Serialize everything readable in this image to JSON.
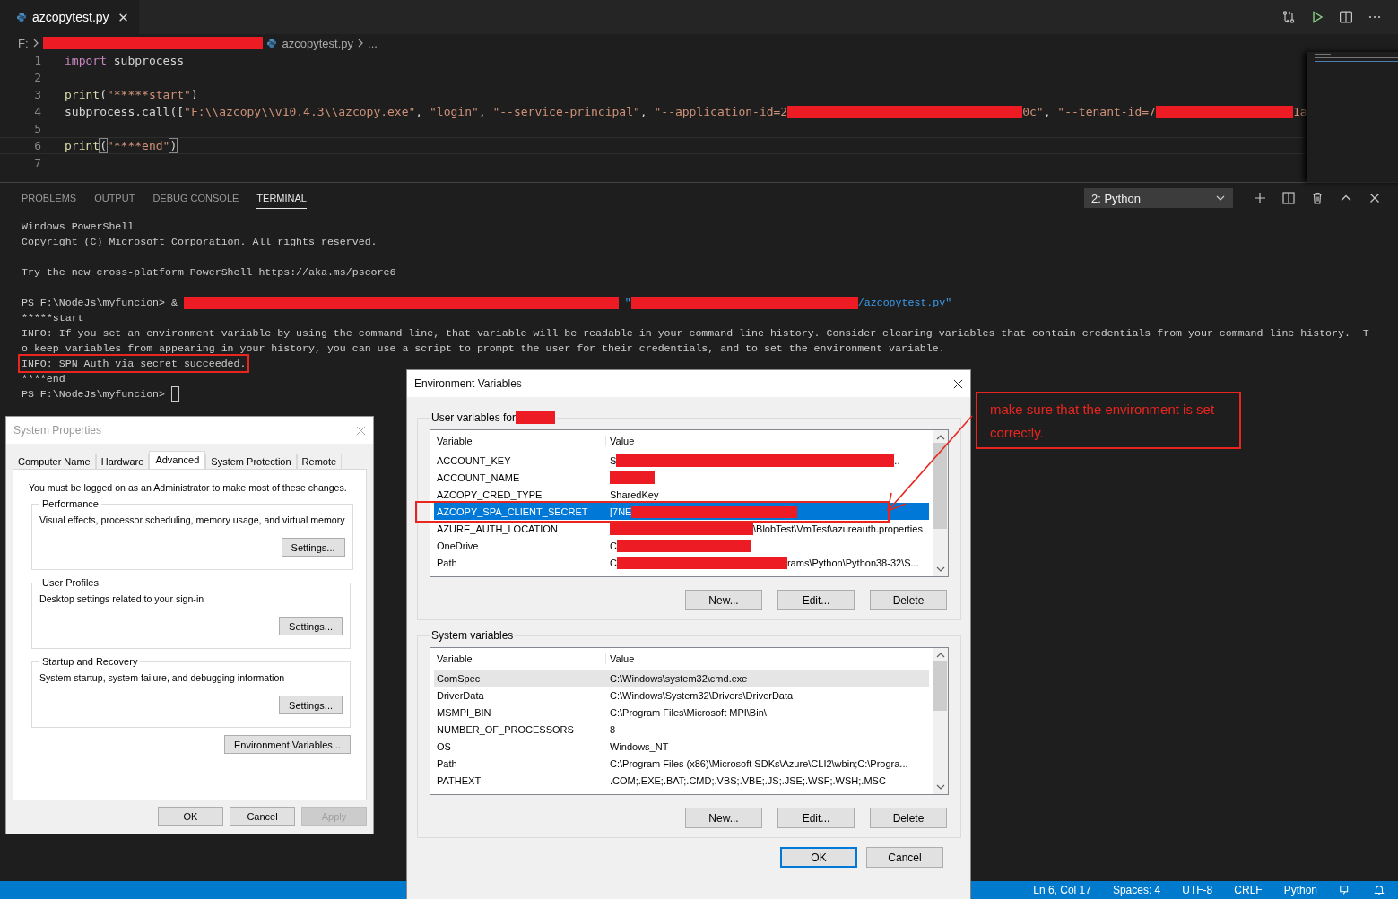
{
  "editor": {
    "tab": {
      "label": "azcopytest.py",
      "selected": true
    },
    "breadcrumb": [
      {
        "kind": "text",
        "text": "F:"
      },
      {
        "kind": "redacted"
      },
      {
        "kind": "file",
        "text": "azcopytest.py"
      },
      {
        "kind": "text",
        "text": "..."
      }
    ],
    "code_lines": [
      {
        "number": "1",
        "current": false,
        "segments": [
          {
            "kind": "keyword",
            "text": "import"
          },
          {
            "kind": "plain",
            "text": " subprocess"
          }
        ]
      },
      {
        "number": "2",
        "current": false
      },
      {
        "number": "3",
        "current": false,
        "segments": [
          {
            "kind": "func",
            "text": "print"
          },
          {
            "kind": "plain",
            "text": "("
          },
          {
            "kind": "string",
            "text": "\"*****start\""
          },
          {
            "kind": "plain",
            "text": ")"
          }
        ]
      },
      {
        "number": "4",
        "current": false,
        "segments": [
          {
            "kind": "plain",
            "text": "subprocess.call(["
          },
          {
            "kind": "string",
            "text": "\"F:\\\\azcopy\\\\v10.4.3\\\\azcopy.exe\""
          },
          {
            "kind": "plain",
            "text": ", "
          },
          {
            "kind": "string",
            "text": "\"login\""
          },
          {
            "kind": "plain",
            "text": ", "
          },
          {
            "kind": "string",
            "text": "\"--service-principal\""
          },
          {
            "kind": "plain",
            "text": ", "
          },
          {
            "kind": "string",
            "text": "\"--application-id=2"
          },
          {
            "kind": "redacted"
          },
          {
            "kind": "string",
            "text": "0c\""
          },
          {
            "kind": "plain",
            "text": ", "
          },
          {
            "kind": "string",
            "text": "\"--tenant-id=7"
          },
          {
            "kind": "redacted"
          },
          {
            "kind": "string",
            "text": "1a"
          }
        ]
      },
      {
        "number": "5",
        "current": false
      },
      {
        "number": "6",
        "current": true,
        "segments": [
          {
            "kind": "func",
            "text": "print"
          },
          {
            "kind": "bracket",
            "text": "("
          },
          {
            "kind": "string",
            "text": "\"****end\""
          },
          {
            "kind": "bracket",
            "text": ")"
          }
        ]
      },
      {
        "number": "7",
        "current": false
      }
    ]
  },
  "panel": {
    "tabs": [
      {
        "label": "PROBLEMS",
        "selected": false
      },
      {
        "label": "OUTPUT",
        "selected": false
      },
      {
        "label": "DEBUG CONSOLE",
        "selected": false
      },
      {
        "label": "TERMINAL",
        "selected": true
      }
    ],
    "terminal_select": "2: Python",
    "terminal_lines": [
      {
        "kind": "text",
        "boxed": false,
        "cursor": false,
        "segments": [
          {
            "kind": "text",
            "text": "Windows PowerShell"
          }
        ]
      },
      {
        "kind": "text",
        "boxed": false,
        "cursor": false,
        "segments": [
          {
            "kind": "text",
            "text": "Copyright (C) Microsoft Corporation. All rights reserved."
          }
        ]
      },
      {
        "kind": "blank"
      },
      {
        "kind": "text",
        "boxed": false,
        "cursor": false,
        "segments": [
          {
            "kind": "text",
            "text": "Try the new cross-platform PowerShell https://aka.ms/pscore6"
          }
        ]
      },
      {
        "kind": "blank"
      },
      {
        "kind": "text",
        "boxed": false,
        "cursor": false,
        "segments": [
          {
            "kind": "text",
            "text": "PS F:\\NodeJs\\myfuncion> & "
          },
          {
            "kind": "redacted"
          },
          {
            "kind": "string",
            "text": " \""
          },
          {
            "kind": "redacted"
          },
          {
            "kind": "string",
            "text": "/azcopytest.py\""
          }
        ]
      },
      {
        "kind": "text",
        "boxed": false,
        "cursor": false,
        "segments": [
          {
            "kind": "text",
            "text": "*****start"
          }
        ]
      },
      {
        "kind": "text",
        "boxed": false,
        "cursor": false,
        "segments": [
          {
            "kind": "text",
            "text": "INFO: If you set an environment variable by using the command line, that variable will be readable in your command line history. Consider clearing variables that contain credentials from your command line history.  T"
          }
        ]
      },
      {
        "kind": "text",
        "boxed": false,
        "cursor": false,
        "segments": [
          {
            "kind": "text",
            "text": "o keep variables from appearing in your history, you can use a script to prompt the user for their credentials, and to set the environment variable."
          }
        ]
      },
      {
        "kind": "text",
        "boxed": true,
        "cursor": false,
        "segments": [
          {
            "kind": "text",
            "text": "INFO: SPN Auth via secret succeeded."
          }
        ]
      },
      {
        "kind": "text",
        "boxed": false,
        "cursor": false,
        "segments": [
          {
            "kind": "text",
            "text": "****end"
          }
        ]
      },
      {
        "kind": "text",
        "boxed": false,
        "cursor": true,
        "segments": [
          {
            "kind": "text",
            "text": "PS F:\\NodeJs\\myfuncion> "
          }
        ]
      }
    ]
  },
  "system_properties": {
    "title": "System Properties",
    "tabs": [
      {
        "label": "Computer Name",
        "selected": false
      },
      {
        "label": "Hardware",
        "selected": false
      },
      {
        "label": "Advanced",
        "selected": true
      },
      {
        "label": "System Protection",
        "selected": false
      },
      {
        "label": "Remote",
        "selected": false
      }
    ],
    "note": "You must be logged on as an Administrator to make most of these changes.",
    "groups": [
      {
        "title": "Performance",
        "description": "Visual effects, processor scheduling, memory usage, and virtual memory",
        "button": "Settings..."
      },
      {
        "title": "User Profiles",
        "description": "Desktop settings related to your sign-in",
        "button": "Settings..."
      },
      {
        "title": "Startup and Recovery",
        "description": "System startup, system failure, and debugging information",
        "button": "Settings..."
      }
    ],
    "env_button": "Environment Variables...",
    "buttons": [
      {
        "label": "OK",
        "disabled": false
      },
      {
        "label": "Cancel",
        "disabled": false
      },
      {
        "label": "Apply",
        "disabled": true
      }
    ]
  },
  "environment_variables": {
    "title": "Environment Variables",
    "user_section": {
      "label": "User variables for",
      "columns": [
        "Variable",
        "Value"
      ],
      "rows": [
        {
          "variable": "ACCOUNT_KEY",
          "selected": false,
          "value": [
            {
              "kind": "text",
              "text": "S"
            },
            {
              "kind": "redacted"
            },
            {
              "kind": "text",
              "text": ".."
            }
          ]
        },
        {
          "variable": "ACCOUNT_NAME",
          "selected": false,
          "value": [
            {
              "kind": "redacted"
            }
          ]
        },
        {
          "variable": "AZCOPY_CRED_TYPE",
          "selected": false,
          "value": [
            {
              "kind": "text",
              "text": "SharedKey"
            }
          ]
        },
        {
          "variable": "AZCOPY_SPA_CLIENT_SECRET",
          "selected": true,
          "value": [
            {
              "kind": "text",
              "text": "[7NE"
            },
            {
              "kind": "redacted"
            }
          ]
        },
        {
          "variable": "AZURE_AUTH_LOCATION",
          "selected": false,
          "value": [
            {
              "kind": "redacted"
            },
            {
              "kind": "text",
              "text": "\\BlobTest\\VmTest\\azureauth.properties"
            }
          ]
        },
        {
          "variable": "OneDrive",
          "selected": false,
          "value": [
            {
              "kind": "text",
              "text": "C"
            },
            {
              "kind": "redacted"
            }
          ]
        },
        {
          "variable": "Path",
          "selected": false,
          "value": [
            {
              "kind": "text",
              "text": "C"
            },
            {
              "kind": "redacted"
            },
            {
              "kind": "text",
              "text": "rams\\Python\\Python38-32\\S..."
            }
          ]
        }
      ],
      "buttons": [
        "New...",
        "Edit...",
        "Delete"
      ]
    },
    "system_section": {
      "label": "System variables",
      "columns": [
        "Variable",
        "Value"
      ],
      "rows": [
        {
          "variable": "ComSpec",
          "selected": true,
          "value": [
            {
              "kind": "text",
              "text": "C:\\Windows\\system32\\cmd.exe"
            }
          ]
        },
        {
          "variable": "DriverData",
          "selected": false,
          "value": [
            {
              "kind": "text",
              "text": "C:\\Windows\\System32\\Drivers\\DriverData"
            }
          ]
        },
        {
          "variable": "MSMPI_BIN",
          "selected": false,
          "value": [
            {
              "kind": "text",
              "text": "C:\\Program Files\\Microsoft MPI\\Bin\\"
            }
          ]
        },
        {
          "variable": "NUMBER_OF_PROCESSORS",
          "selected": false,
          "value": [
            {
              "kind": "text",
              "text": "8"
            }
          ]
        },
        {
          "variable": "OS",
          "selected": false,
          "value": [
            {
              "kind": "text",
              "text": "Windows_NT"
            }
          ]
        },
        {
          "variable": "Path",
          "selected": false,
          "value": [
            {
              "kind": "text",
              "text": "C:\\Program Files (x86)\\Microsoft SDKs\\Azure\\CLI2\\wbin;C:\\Progra..."
            }
          ]
        },
        {
          "variable": "PATHEXT",
          "selected": false,
          "value": [
            {
              "kind": "text",
              "text": ".COM;.EXE;.BAT;.CMD;.VBS;.VBE;.JS;.JSE;.WSF;.WSH;.MSC"
            }
          ]
        }
      ],
      "buttons": [
        "New...",
        "Edit...",
        "Delete"
      ]
    },
    "buttons": [
      {
        "label": "OK",
        "default": true
      },
      {
        "label": "Cancel",
        "default": false
      }
    ]
  },
  "annotation": {
    "text": "make sure that the environment is set correctly."
  },
  "status_bar": {
    "items": [
      "Ln 6, Col 17",
      "Spaces: 4",
      "UTF-8",
      "CRLF",
      "Python"
    ]
  }
}
